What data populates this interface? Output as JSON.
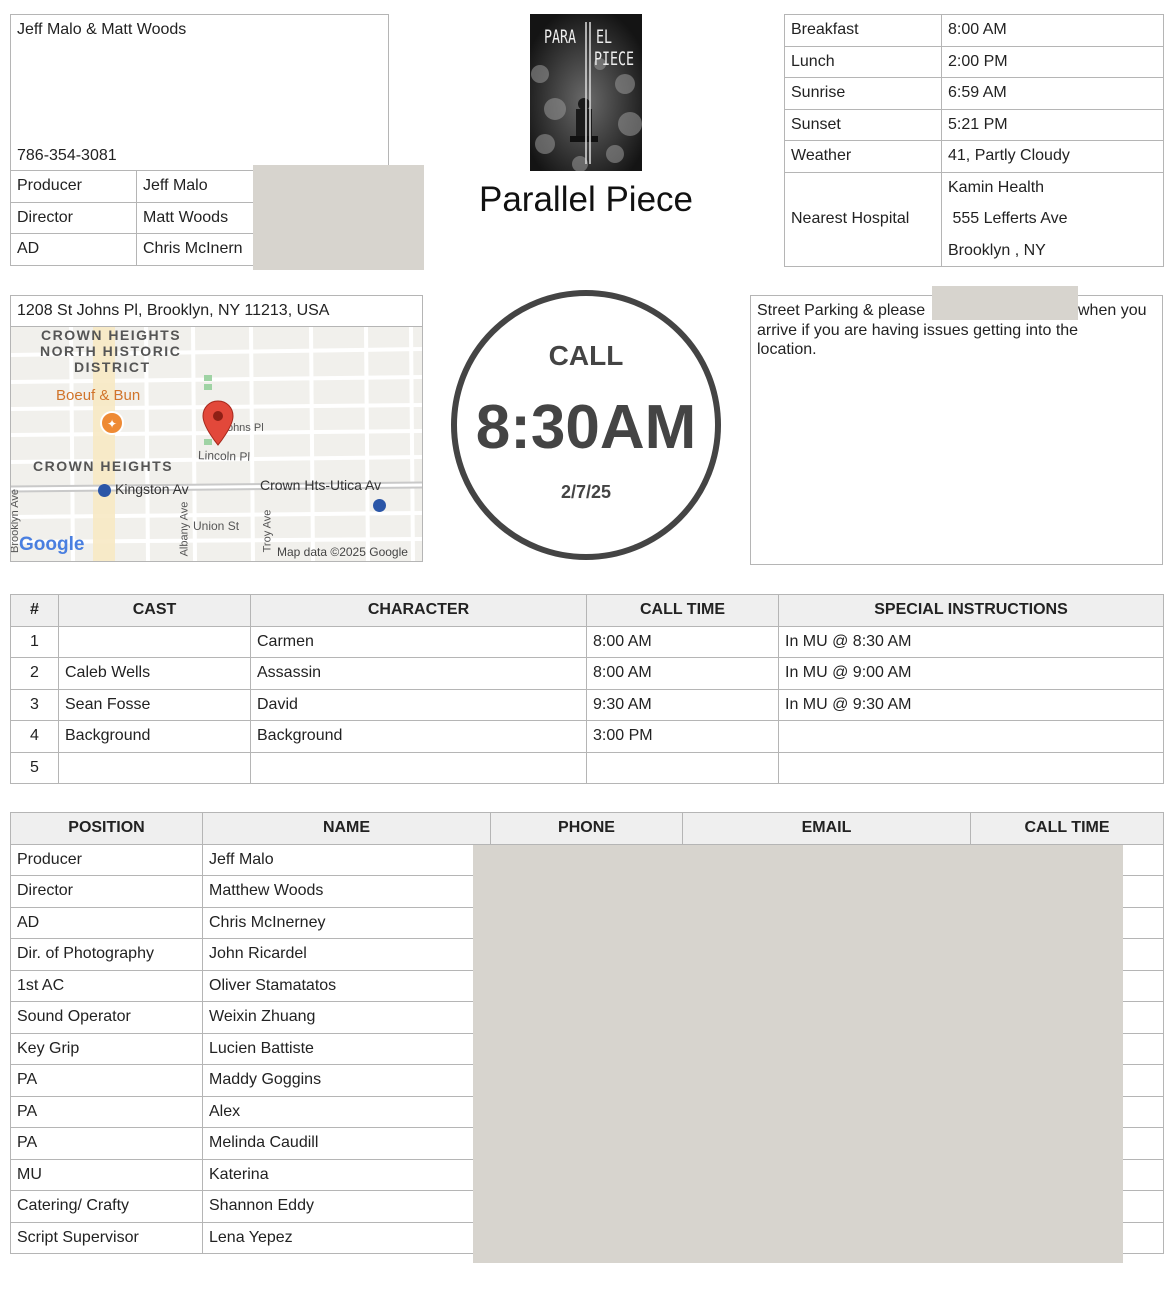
{
  "contact": {
    "names": "Jeff Malo & Matt Woods",
    "phone": "786-354-3081"
  },
  "key_crew": [
    {
      "role": "Producer",
      "name": "Jeff Malo"
    },
    {
      "role": "Director",
      "name": "Matt Woods"
    },
    {
      "role": "AD",
      "name": "Chris McInern"
    }
  ],
  "poster": {
    "line1": "PARA",
    "line2": "EL",
    "line3": "PIECE"
  },
  "project_title": "Parallel Piece",
  "schedule": [
    {
      "label": "Breakfast",
      "value": "8:00 AM"
    },
    {
      "label": "Lunch",
      "value": "2:00 PM"
    },
    {
      "label": "Sunrise",
      "value": "6:59 AM"
    },
    {
      "label": "Sunset",
      "value": "5:21 PM"
    },
    {
      "label": "Weather",
      "value": "41, Partly Cloudy"
    }
  ],
  "hospital": {
    "label": "Nearest Hospital",
    "name": "Kamin Health",
    "street": " 555 Lefferts Ave",
    "city": "Brooklyn , NY"
  },
  "location": {
    "address": "1208 St Johns Pl, Brooklyn, NY 11213, USA",
    "map": {
      "district1": "CROWN HEIGHTS",
      "district2": "NORTH HISTORIC",
      "district3": "DISTRICT",
      "district4": "CROWN HEIGHTS",
      "restaurant": "Boeuf & Bun",
      "st_johns": "St Johns Pl",
      "lincoln": "Lincoln Pl",
      "kingston": "Kingston Av",
      "utica": "Crown Hts-Utica Av",
      "union": "Union St",
      "brooklyn_ave": "Brooklyn Ave",
      "albany_ave": "Albany Ave",
      "troy_ave": "Troy Ave",
      "logo": "Google",
      "attribution": "Map data ©2025 Google"
    }
  },
  "call": {
    "label": "CALL",
    "time": "8:30AM",
    "date": "2/7/25"
  },
  "parking_note": {
    "before": "Street Parking & please",
    "after": "when you",
    "rest": "arrive if you are having issues getting into the location."
  },
  "cast_table": {
    "headers": [
      "#",
      "CAST",
      "CHARACTER",
      "CALL TIME",
      "SPECIAL INSTRUCTIONS"
    ],
    "rows": [
      [
        "1",
        "",
        "Carmen",
        "8:00 AM",
        "In MU @ 8:30 AM"
      ],
      [
        "2",
        "Caleb Wells",
        "Assassin",
        "8:00 AM",
        "In MU @ 9:00 AM"
      ],
      [
        "3",
        "Sean Fosse",
        "David",
        "9:30 AM",
        "In MU @ 9:30 AM"
      ],
      [
        "4",
        "Background",
        "Background",
        "3:00 PM",
        ""
      ],
      [
        "5",
        "",
        "",
        "",
        ""
      ]
    ]
  },
  "crew_table": {
    "headers": [
      "POSITION",
      "NAME",
      "PHONE",
      "EMAIL",
      "CALL TIME"
    ],
    "rows": [
      [
        "Producer",
        "Jeff Malo"
      ],
      [
        "Director",
        "Matthew Woods"
      ],
      [
        "AD",
        "Chris McInerney"
      ],
      [
        "Dir. of Photography",
        "John Ricardel"
      ],
      [
        "1st AC",
        "Oliver Stamatatos"
      ],
      [
        "Sound Operator",
        "Weixin Zhuang"
      ],
      [
        "Key Grip",
        "Lucien Battiste"
      ],
      [
        "PA",
        "Maddy Goggins"
      ],
      [
        "PA",
        "Alex"
      ],
      [
        "PA",
        "Melinda Caudill"
      ],
      [
        "MU",
        "Katerina"
      ],
      [
        "Catering/ Crafty",
        "Shannon Eddy"
      ],
      [
        "Script Supervisor",
        "Lena Yepez"
      ]
    ]
  }
}
